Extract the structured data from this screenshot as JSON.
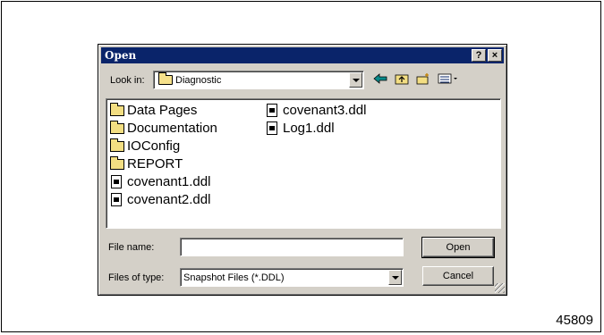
{
  "dialog": {
    "title": "Open",
    "help_label": "?",
    "close_label": "×"
  },
  "lookin": {
    "label": "Look in:",
    "value": "Diagnostic"
  },
  "toolbar": {
    "icons": [
      "back-icon",
      "up-folder-icon",
      "new-folder-icon",
      "view-menu-icon"
    ]
  },
  "files": [
    {
      "name": "Data Pages",
      "type": "folder"
    },
    {
      "name": "Documentation",
      "type": "folder"
    },
    {
      "name": "IOConfig",
      "type": "folder"
    },
    {
      "name": "REPORT",
      "type": "folder"
    },
    {
      "name": "covenant1.ddl",
      "type": "file"
    },
    {
      "name": "covenant2.ddl",
      "type": "file"
    },
    {
      "name": "covenant3.ddl",
      "type": "file"
    },
    {
      "name": "Log1.ddl",
      "type": "file"
    }
  ],
  "filename": {
    "label": "File name:",
    "value": ""
  },
  "filetype": {
    "label": "Files of type:",
    "value": "Snapshot Files (*.DDL)"
  },
  "buttons": {
    "open": "Open",
    "cancel": "Cancel"
  },
  "figure_number": "45809",
  "colors": {
    "titlebar": "#0a246a",
    "dialog_bg": "#d4d0c8",
    "folder": "#f3de82"
  }
}
